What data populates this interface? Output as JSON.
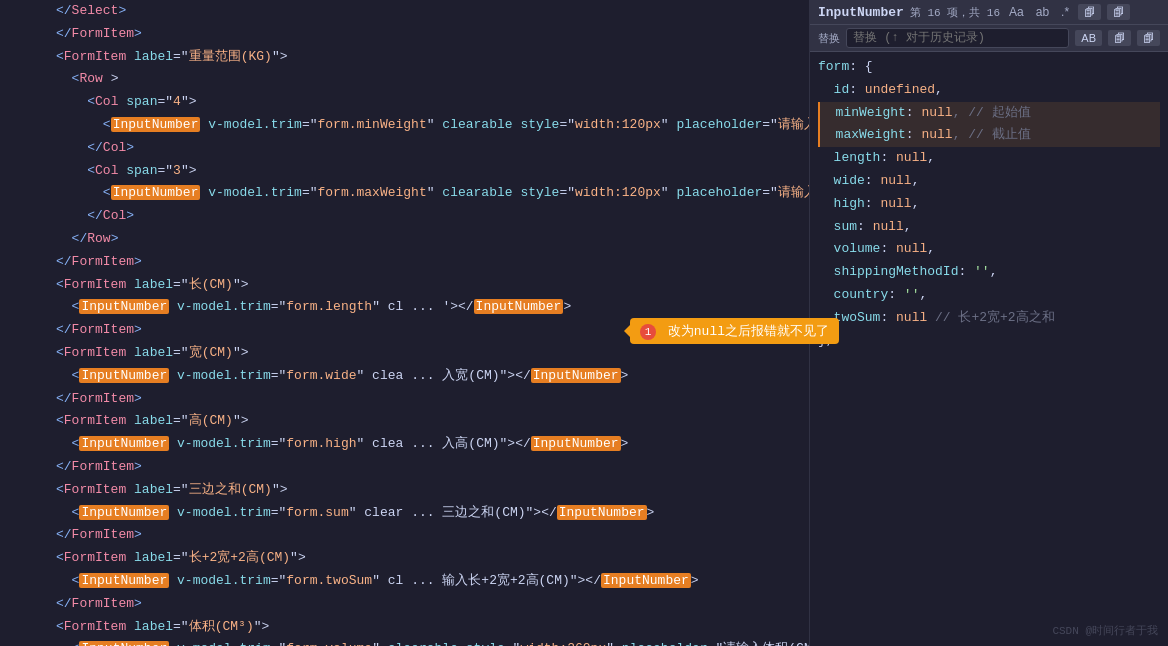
{
  "editor": {
    "title": "InputNumber",
    "search_meta": "第 16 项，共 16",
    "search_placeholder": "InputNumber",
    "replace_placeholder": "替换 (↑ 对于历史记录)",
    "match_case_label": "Aa",
    "match_word_label": "ab",
    "regex_label": ".*",
    "close_label": "×"
  },
  "left_lines": [
    {
      "num": "",
      "content": "lt_select_close"
    },
    {
      "num": "",
      "content": "lt_formitem_close"
    },
    {
      "num": "",
      "content": "lt_formitem_label_weight"
    },
    {
      "num": "",
      "content": "lt_row_open"
    },
    {
      "num": "",
      "content": "lt_col_span4"
    },
    {
      "num": "",
      "content": "lt_inputnumber_minweight"
    },
    {
      "num": "",
      "content": "lt_col_close"
    },
    {
      "num": "",
      "content": "lt_col_span3"
    },
    {
      "num": "",
      "content": "lt_inputnumber_maxweight"
    },
    {
      "num": "",
      "content": "lt_col_close2"
    },
    {
      "num": "",
      "content": "lt_row_close"
    },
    {
      "num": "",
      "content": "lt_formitem_close2"
    },
    {
      "num": "",
      "content": "lt_formitem_label_length"
    },
    {
      "num": "",
      "content": "lt_inputnumber_length"
    },
    {
      "num": "",
      "content": "lt_formitem_close3"
    },
    {
      "num": "",
      "content": "lt_formitem_label_wide"
    },
    {
      "num": "",
      "content": "lt_inputnumber_wide"
    },
    {
      "num": "",
      "content": "lt_formitem_close4"
    },
    {
      "num": "",
      "content": "lt_formitem_label_high"
    },
    {
      "num": "",
      "content": "lt_inputnumber_high"
    },
    {
      "num": "",
      "content": "lt_formitem_close5"
    },
    {
      "num": "",
      "content": "lt_formitem_label_sum"
    },
    {
      "num": "",
      "content": "lt_inputnumber_sum"
    },
    {
      "num": "",
      "content": "lt_formitem_close6"
    },
    {
      "num": "",
      "content": "lt_formitem_label_twosum"
    },
    {
      "num": "",
      "content": "lt_inputnumber_twosum"
    },
    {
      "num": "",
      "content": "lt_formitem_close7"
    },
    {
      "num": "",
      "content": "lt_formitem_label_volume"
    },
    {
      "num": "",
      "content": "lt_inputnumber_volume"
    }
  ],
  "right_code": {
    "lines": [
      "form: {",
      "  id: undefined,",
      "  minWeight: null, // 起始值",
      "  maxWeight: null, // 截止值",
      "  length: null,",
      "  wide: null,",
      "  high: null,",
      "  sum: null,",
      "  volume: null,",
      "  shippingMethodId: '',",
      "  country: '',",
      "  twoSum: null // 长+2宽+2高之和",
      "},"
    ],
    "tooltip": "改为null之后报错就不见了"
  },
  "watermark": "CSDN @时间行者于我"
}
